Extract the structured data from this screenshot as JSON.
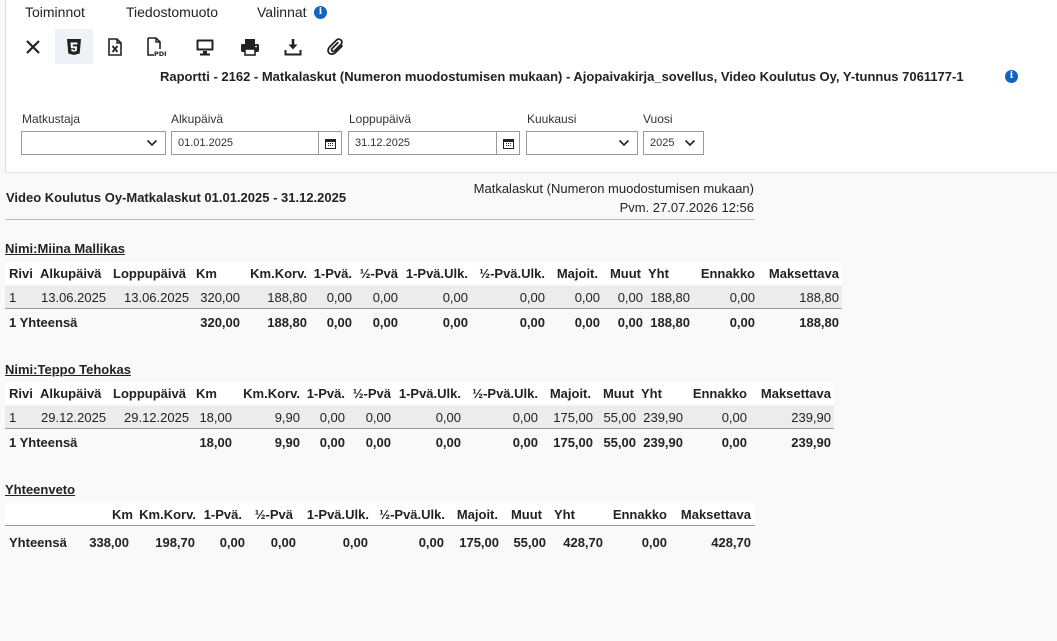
{
  "menu": [
    "Toiminnot",
    "Tiedostomuoto",
    "Valinnat"
  ],
  "report_title": "Raportti - 2162 - Matkalaskut (Numeron muodostumisen mukaan) - Ajopaivakirja_sovellus, Video Koulutus Oy, Y-tunnus 7061177-1",
  "filters": {
    "matkustaja": {
      "label": "Matkustaja",
      "value": ""
    },
    "alkupaiva": {
      "label": "Alkupäivä",
      "value": "01.01.2025"
    },
    "loppupaiva": {
      "label": "Loppupäivä",
      "value": "31.12.2025"
    },
    "kuukausi": {
      "label": "Kuukausi",
      "value": ""
    },
    "vuosi": {
      "label": "Vuosi",
      "value": "2025"
    }
  },
  "report": {
    "company_title": "Video Koulutus Oy-Matkalaskut  01.01.2025  - 31.12.2025",
    "right_title": "Matkalaskut (Numeron muodostumisen mukaan)",
    "date_line": "Pvm. 27.07.2026 12:56",
    "columns": [
      "Rivi",
      "Alkupäivä",
      "Loppupäivä",
      "Km",
      "Km.Korv.",
      "1-Pvä.",
      "½-Pvä",
      "1-Pvä.Ulk.",
      "½-Pvä.Ulk.",
      "Majoit.",
      "Muut",
      "Yht",
      "Ennakko",
      "Maksettava"
    ],
    "people": [
      {
        "name": "Nimi:Miina Mallikas",
        "rows": [
          [
            "1",
            "13.06.2025",
            "13.06.2025",
            "320,00",
            "188,80",
            "0,00",
            "0,00",
            "0,00",
            "0,00",
            "0,00",
            "0,00",
            "188,80",
            "0,00",
            "188,80"
          ]
        ],
        "total": [
          "1 Yhteensä",
          "",
          "",
          "320,00",
          "188,80",
          "0,00",
          "0,00",
          "0,00",
          "0,00",
          "0,00",
          "0,00",
          "188,80",
          "0,00",
          "188,80"
        ]
      },
      {
        "name": "Nimi:Teppo Tehokas",
        "rows": [
          [
            "1",
            "29.12.2025",
            "29.12.2025",
            "18,00",
            "9,90",
            "0,00",
            "0,00",
            "0,00",
            "0,00",
            "175,00",
            "55,00",
            "239,90",
            "0,00",
            "239,90"
          ]
        ],
        "total": [
          "1 Yhteensä",
          "",
          "",
          "18,00",
          "9,90",
          "0,00",
          "0,00",
          "0,00",
          "0,00",
          "175,00",
          "55,00",
          "239,90",
          "0,00",
          "239,90"
        ]
      }
    ],
    "summary": {
      "title": "Yhteenveto",
      "columns": [
        "",
        "Km",
        "Km.Korv.",
        "1-Pvä.",
        "½-Pvä",
        "1-Pvä.Ulk.",
        "½-Pvä.Ulk.",
        "Majoit.",
        "Muut",
        "Yht",
        "Ennakko",
        "Maksettava"
      ],
      "row": [
        "Yhteensä",
        "338,00",
        "198,70",
        "0,00",
        "0,00",
        "0,00",
        "0,00",
        "175,00",
        "55,00",
        "428,70",
        "0,00",
        "428,70"
      ]
    }
  },
  "colors": {
    "info": "#1565c0",
    "row_bg": "#ececec"
  }
}
